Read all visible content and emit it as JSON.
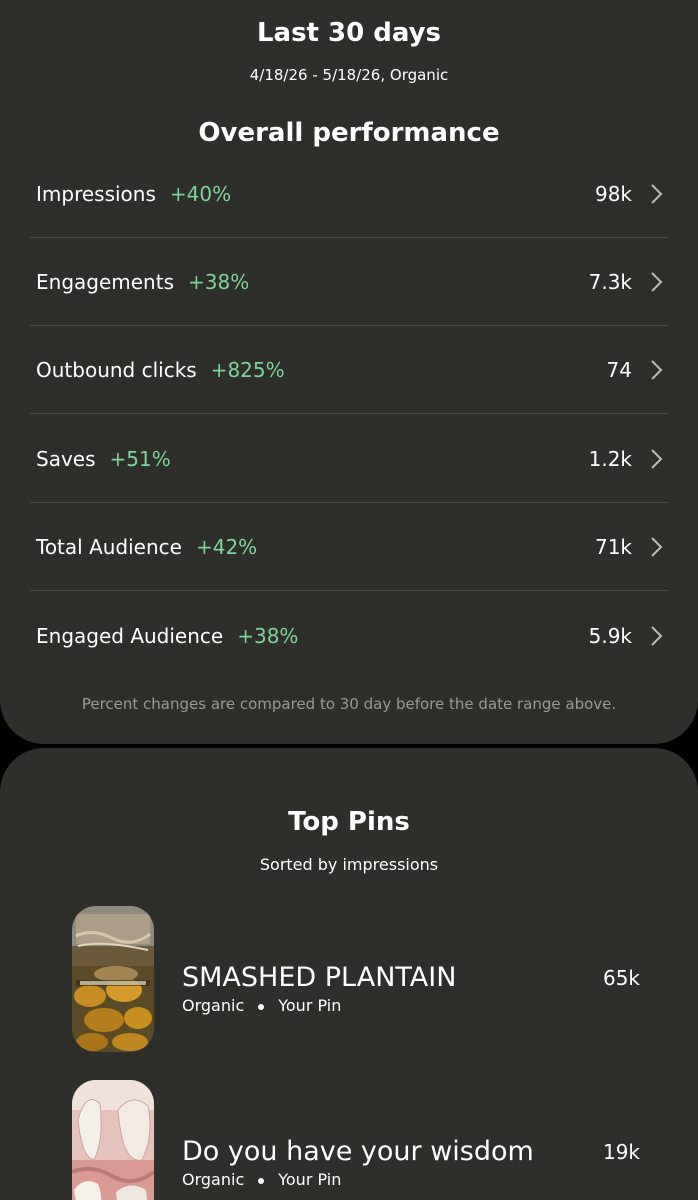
{
  "header": {
    "title": "Last 30 days",
    "date_range": "4/18/26 - 5/18/26, Organic"
  },
  "overall": {
    "title": "Overall performance",
    "metrics": [
      {
        "label": "Impressions",
        "change": "+40%",
        "value": "98k"
      },
      {
        "label": "Engagements",
        "change": "+38%",
        "value": "7.3k"
      },
      {
        "label": "Outbound clicks",
        "change": "+825%",
        "value": "74"
      },
      {
        "label": "Saves",
        "change": "+51%",
        "value": "1.2k"
      },
      {
        "label": "Total Audience",
        "change": "+42%",
        "value": "71k"
      },
      {
        "label": "Engaged Audience",
        "change": "+38%",
        "value": "5.9k"
      }
    ],
    "footnote": "Percent changes are compared to 30 day before the date range above."
  },
  "top_pins": {
    "title": "Top Pins",
    "subtitle": "Sorted by impressions",
    "pins": [
      {
        "title": "SMASHED PLANTAIN",
        "source": "Organic",
        "owner": "Your Pin",
        "value": "65k"
      },
      {
        "title": "Do you have your wisdom",
        "source": "Organic",
        "owner": "Your Pin",
        "value": "19k"
      }
    ]
  },
  "colors": {
    "background": "#000000",
    "card": "#2e2e2a",
    "positive_change": "#7fd49a",
    "muted_text": "#9a9a95",
    "divider": "#4a4a46"
  }
}
